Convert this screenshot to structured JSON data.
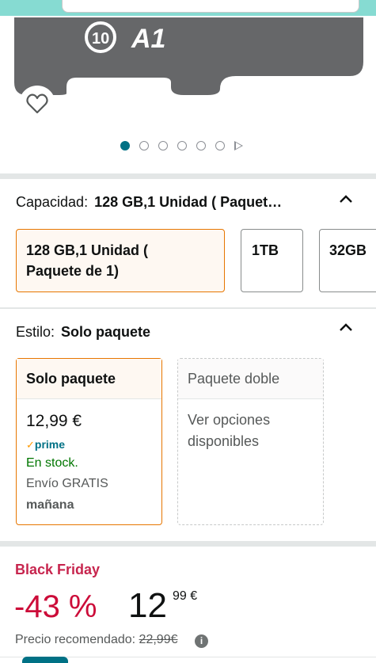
{
  "product_image": {
    "card_logo": "A1",
    "card_class": "10"
  },
  "carousel": {
    "total_images": 6,
    "active_index": 0
  },
  "capacity": {
    "label": "Capacidad:",
    "selected_value": "128 GB,1 Unidad ( Paquet…",
    "options": [
      {
        "line1": "128 GB,1 Unidad (",
        "line2": "Paquete de 1)",
        "selected": true
      },
      {
        "line1": "1TB",
        "selected": false
      },
      {
        "line1": "32GB",
        "selected": false
      }
    ]
  },
  "style": {
    "label": "Estilo:",
    "selected_value": "Solo paquete",
    "options": [
      {
        "name": "Solo paquete",
        "price": "12,99 €",
        "prime": "prime",
        "stock": "En stock.",
        "shipping": "Envío GRATIS",
        "delivery": "mañana",
        "selected": true
      },
      {
        "name": "Paquete doble",
        "note_line1": "Ver opciones",
        "note_line2": "disponibles",
        "selected": false
      }
    ]
  },
  "deal": {
    "badge": "Black Friday",
    "discount": "-43 %",
    "price_whole": "12",
    "price_fraction": "99 €",
    "recommended_label": "Precio recomendado:",
    "recommended_price": "22,99€",
    "info_icon": "i"
  },
  "colors": {
    "accent_orange": "#e77600",
    "teal": "#007185",
    "deal_red": "#cc0c39",
    "stock_green": "#007600"
  },
  "icons": {
    "favorite": "heart-outline-icon",
    "collapse": "chevron-up-icon",
    "info": "info-circle-icon",
    "carousel_play": "play-icon"
  }
}
